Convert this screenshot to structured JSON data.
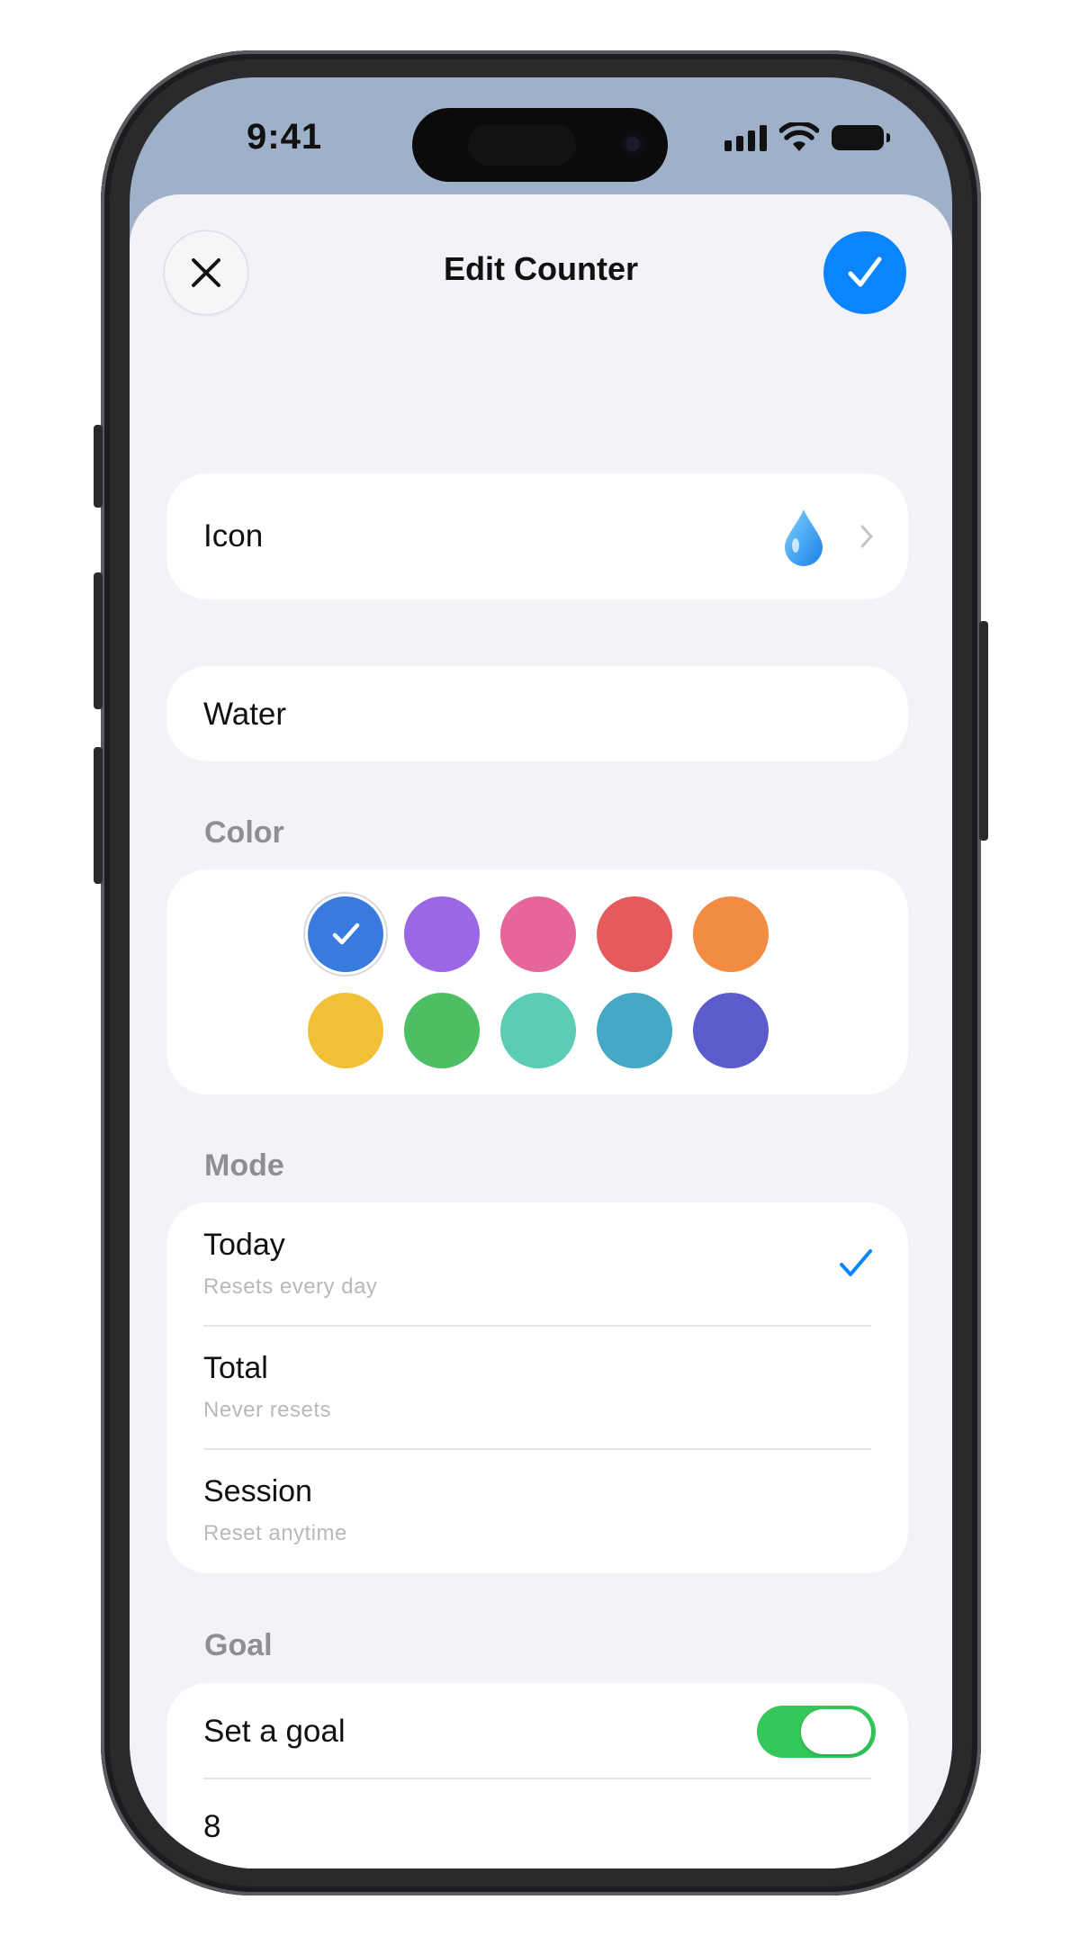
{
  "status_bar": {
    "time": "9:41"
  },
  "sheet": {
    "title": "Edit Counter",
    "close_icon": "close-icon",
    "done_icon": "checkmark-icon"
  },
  "icon_row": {
    "label": "Icon",
    "value_icon": "water-drop-icon",
    "chevron": "chevron-right-icon"
  },
  "name_field": {
    "value": "Water"
  },
  "color_section": {
    "header": "Color",
    "selected_index": 0,
    "swatches": [
      "#3a7be0",
      "#9b67e4",
      "#e6659a",
      "#e55a5a",
      "#f28c42",
      "#f2c037",
      "#4dbe63",
      "#5ccdb4",
      "#45a8c4",
      "#5b5bcc"
    ]
  },
  "mode_section": {
    "header": "Mode",
    "options": [
      {
        "title": "Today",
        "subtitle": "Resets every day",
        "selected": true
      },
      {
        "title": "Total",
        "subtitle": "Never resets",
        "selected": false
      },
      {
        "title": "Session",
        "subtitle": "Reset anytime",
        "selected": false
      }
    ]
  },
  "goal_section": {
    "header": "Goal",
    "toggle_label": "Set a goal",
    "toggle_on": true,
    "goal_value": "8"
  },
  "colors": {
    "accent": "#0a84ff",
    "toggle_on": "#34c759",
    "background": "#f2f2f7"
  }
}
